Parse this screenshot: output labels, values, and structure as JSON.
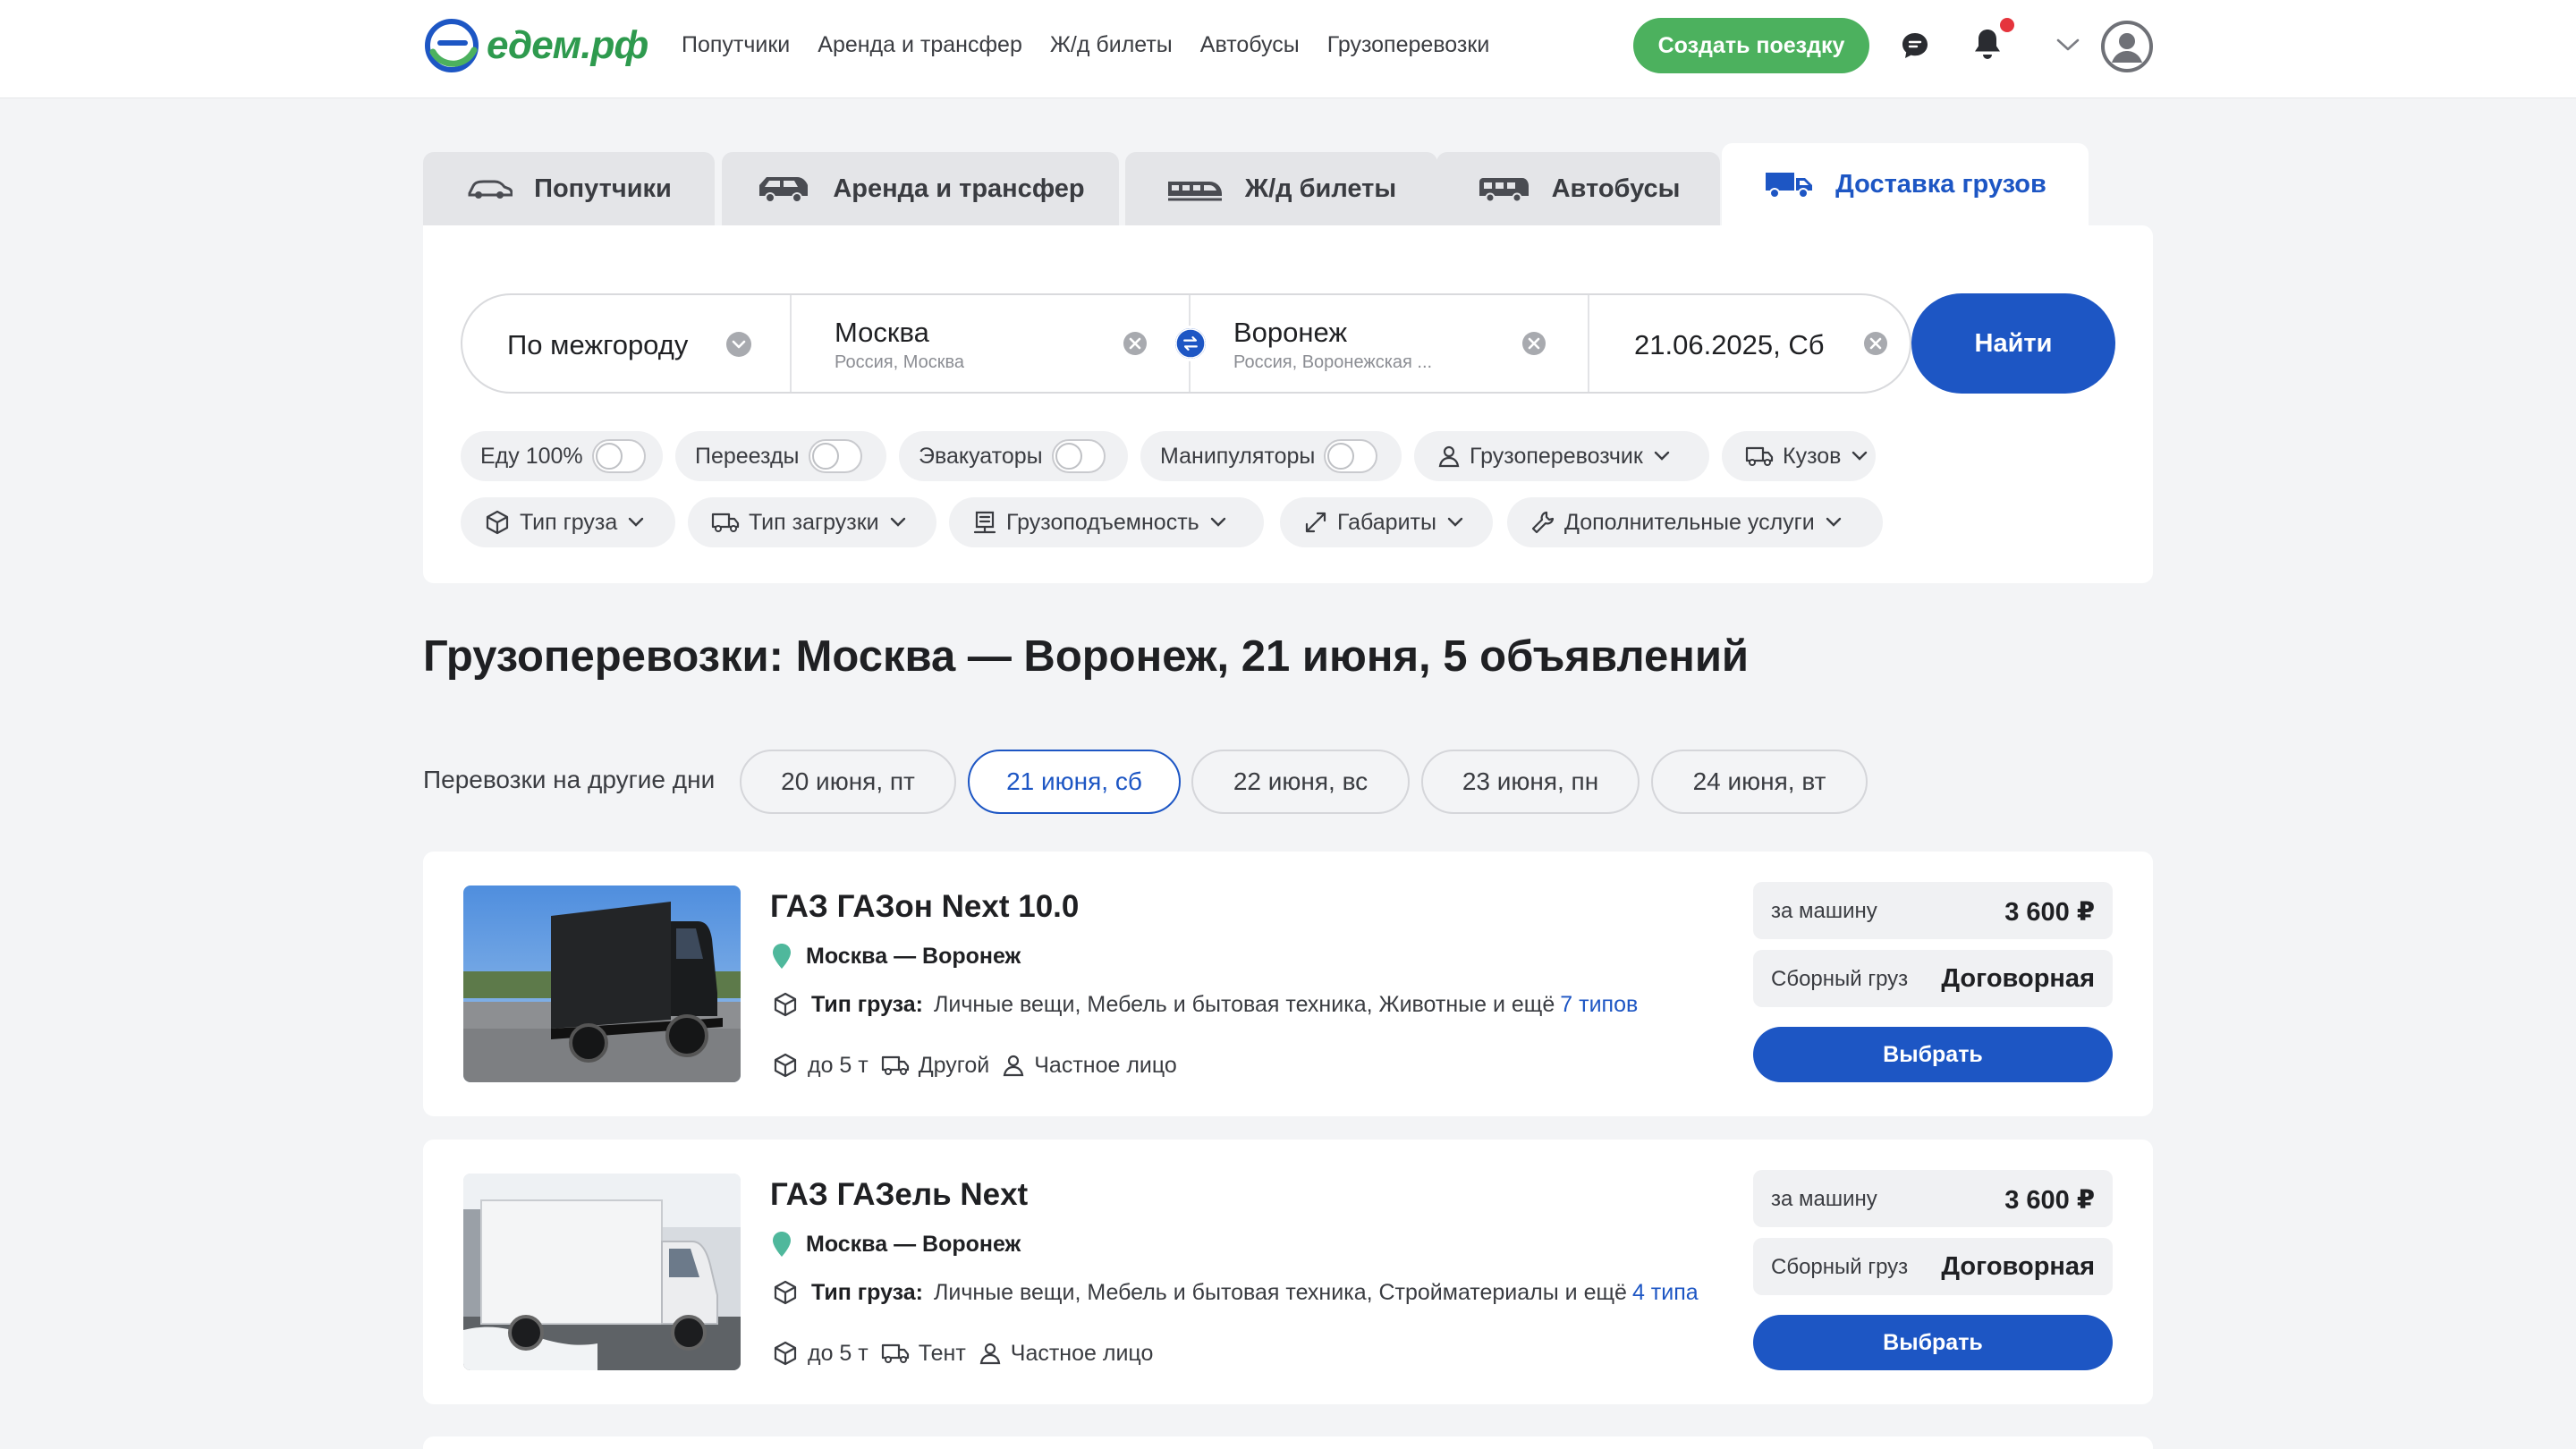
{
  "header": {
    "logo_text": "едем.рф",
    "nav": [
      "Попутчики",
      "Аренда и трансфер",
      "Ж/д билеты",
      "Автобусы",
      "Грузоперевозки"
    ],
    "create_trip": "Создать поездку"
  },
  "tabs": [
    {
      "label": "Попутчики",
      "icon": "car-icon"
    },
    {
      "label": "Аренда и трансфер",
      "icon": "minivan-icon"
    },
    {
      "label": "Ж/д билеты",
      "icon": "train-icon"
    },
    {
      "label": "Автобусы",
      "icon": "bus-icon"
    },
    {
      "label": "Доставка грузов",
      "icon": "truck-icon",
      "active": true
    }
  ],
  "search": {
    "trip_type": "По межгороду",
    "from_city": "Москва",
    "from_region": "Россия, Москва",
    "to_city": "Воронеж",
    "to_region": "Россия, Воронежская ...",
    "date": "21.06.2025, Сб",
    "find": "Найти"
  },
  "filters": {
    "toggles": [
      {
        "label": "Еду 100%",
        "on": false
      },
      {
        "label": "Переезды",
        "on": false
      },
      {
        "label": "Эвакуаторы",
        "on": false
      },
      {
        "label": "Манипуляторы",
        "on": false
      }
    ],
    "dropdowns_row1": [
      {
        "label": "Грузоперевозчик",
        "icon": "person-icon"
      },
      {
        "label": "Кузов",
        "icon": "truck-small-icon"
      }
    ],
    "dropdowns_row2": [
      {
        "label": "Тип груза",
        "icon": "box-icon"
      },
      {
        "label": "Тип загрузки",
        "icon": "truck-small-icon"
      },
      {
        "label": "Грузоподъемность",
        "icon": "scale-icon"
      },
      {
        "label": "Габариты",
        "icon": "dimensions-icon"
      },
      {
        "label": "Дополнительные услуги",
        "icon": "wrench-icon"
      }
    ]
  },
  "results": {
    "title": "Грузоперевозки: Москва — Воронеж, 21 июня, 5 объявлений",
    "other_days_label": "Перевозки на другие дни",
    "days": [
      {
        "label": "20 июня, пт",
        "active": false
      },
      {
        "label": "21 июня, сб",
        "active": true
      },
      {
        "label": "22 июня, вс",
        "active": false
      },
      {
        "label": "23 июня, пн",
        "active": false
      },
      {
        "label": "24 июня, вт",
        "active": false
      }
    ]
  },
  "listings": [
    {
      "title": "ГАЗ ГАЗон Next 10.0",
      "route": "Москва — Воронеж",
      "cargo_key": "Тип груза:",
      "cargo_value": "Личные вещи, Мебель и бытовая техника, Животные и ещё",
      "cargo_more": "7 типов",
      "capacity": "до 5 т",
      "body": "Другой",
      "owner": "Частное лицо",
      "price_label": "за машину",
      "price": "3 600 ₽",
      "group_label": "Сборный груз",
      "group_price": "Договорная",
      "select": "Выбрать"
    },
    {
      "title": "ГАЗ ГАЗель Next",
      "route": "Москва — Воронеж",
      "cargo_key": "Тип груза:",
      "cargo_value": "Личные вещи, Мебель и бытовая техника, Стройматериалы и ещё",
      "cargo_more": "4 типа",
      "capacity": "до 5 т",
      "body": "Тент",
      "owner": "Частное лицо",
      "price_label": "за машину",
      "price": "3 600 ₽",
      "group_label": "Сборный груз",
      "group_price": "Договорная",
      "select": "Выбрать"
    }
  ],
  "colors": {
    "brand_green": "#4cb15e",
    "primary_blue": "#1d56c4",
    "notification_red": "#e5343c"
  }
}
